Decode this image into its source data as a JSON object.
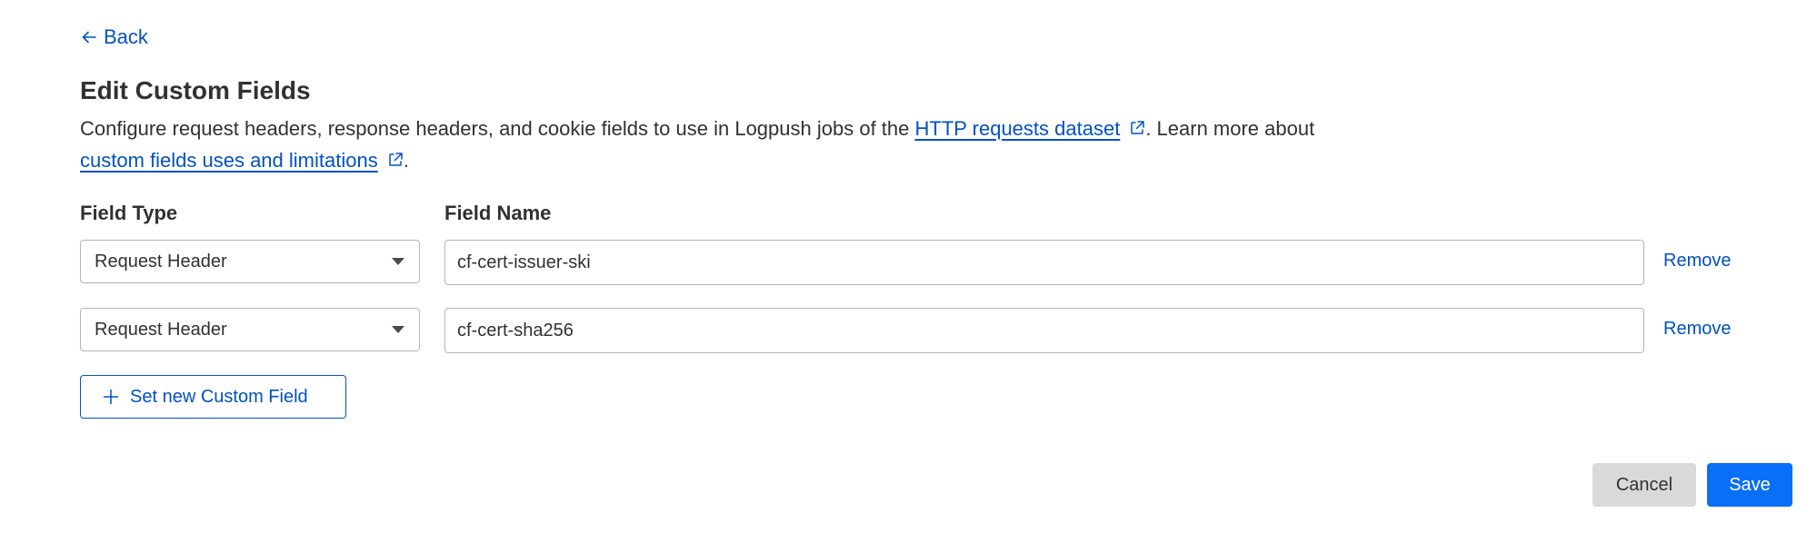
{
  "nav": {
    "back_label": "Back",
    "back_icon": "arrow-left-icon"
  },
  "header": {
    "title": "Edit Custom Fields"
  },
  "description": {
    "text_before_link1": "Configure request headers, response headers, and cookie fields to use in Logpush jobs of the ",
    "link1_label": "HTTP requests dataset",
    "text_between": ". Learn more about",
    "link2_label": "custom fields uses and limitations",
    "text_after": ".",
    "link_icon": "external-link-icon"
  },
  "columns": {
    "field_type_label": "Field Type",
    "field_name_label": "Field Name"
  },
  "fields": [
    {
      "type": "Request Header",
      "name": "cf-cert-issuer-ski",
      "remove_label": "Remove"
    },
    {
      "type": "Request Header",
      "name": "cf-cert-sha256",
      "remove_label": "Remove"
    }
  ],
  "actions": {
    "add_label": "Set new Custom Field",
    "add_icon": "plus-icon",
    "cancel_label": "Cancel",
    "save_label": "Save"
  },
  "colors": {
    "link": "#0051c3",
    "primary": "#0a6ff7",
    "secondary_bg": "#d9d9d9",
    "text": "#313131"
  }
}
